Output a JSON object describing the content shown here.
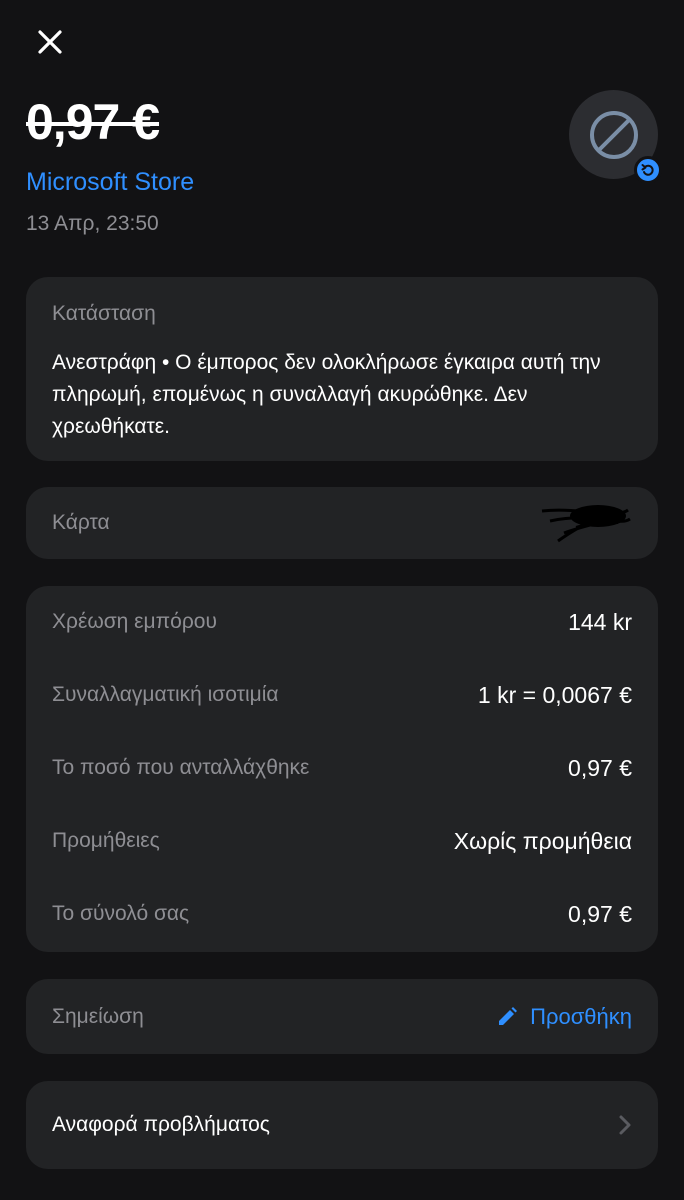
{
  "header": {
    "amount": "0,97 €",
    "merchant": "Microsoft Store",
    "datetime": "13 Απρ, 23:50",
    "avatar_icon": "blocked-icon",
    "badge_icon": "undo-icon"
  },
  "status": {
    "label": "Κατάσταση",
    "text": "Ανεστράφη • Ο έμπορος δεν ολοκλήρωσε έγκαιρα αυτή την πληρωμή, επομένως η συναλλαγή ακυρώθηκε. Δεν χρεωθήκατε."
  },
  "card": {
    "label": "Κάρτα"
  },
  "details": {
    "rows": [
      {
        "label": "Χρέωση εμπόρου",
        "value": "144 kr"
      },
      {
        "label": "Συναλλαγματική ισοτιμία",
        "value": "1 kr = 0,0067 €"
      },
      {
        "label": "Το ποσό που ανταλλάχθηκε",
        "value": "0,97 €"
      },
      {
        "label": "Προμήθειες",
        "value": "Χωρίς προμήθεια"
      },
      {
        "label": "Το σύνολό σας",
        "value": "0,97 €"
      }
    ]
  },
  "note": {
    "label": "Σημείωση",
    "action_label": "Προσθήκη",
    "action_icon": "pencil-icon"
  },
  "report": {
    "label": "Αναφορά προβλήματος",
    "icon": "chevron-right-icon"
  },
  "colors": {
    "background": "#121214",
    "card": "#222325",
    "accent": "#2f8fff",
    "secondary_text": "#8e8e93"
  }
}
